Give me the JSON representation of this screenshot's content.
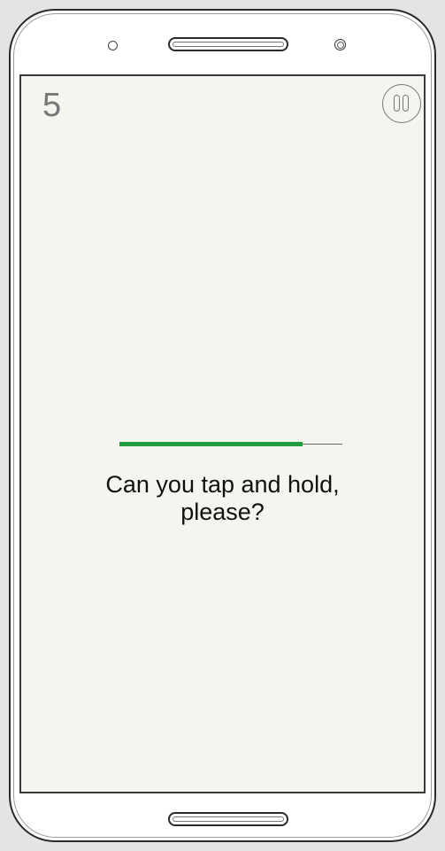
{
  "game": {
    "level": "5",
    "prompt_line1": "Can you tap and hold,",
    "prompt_line2": "please?",
    "progress": 0.82
  },
  "colors": {
    "background": "#f5f5ef",
    "progress_fill": "#1f9e3e",
    "progress_track": "#666666",
    "level_number": "#777777"
  },
  "icons": {
    "pause": "pause-icon"
  }
}
